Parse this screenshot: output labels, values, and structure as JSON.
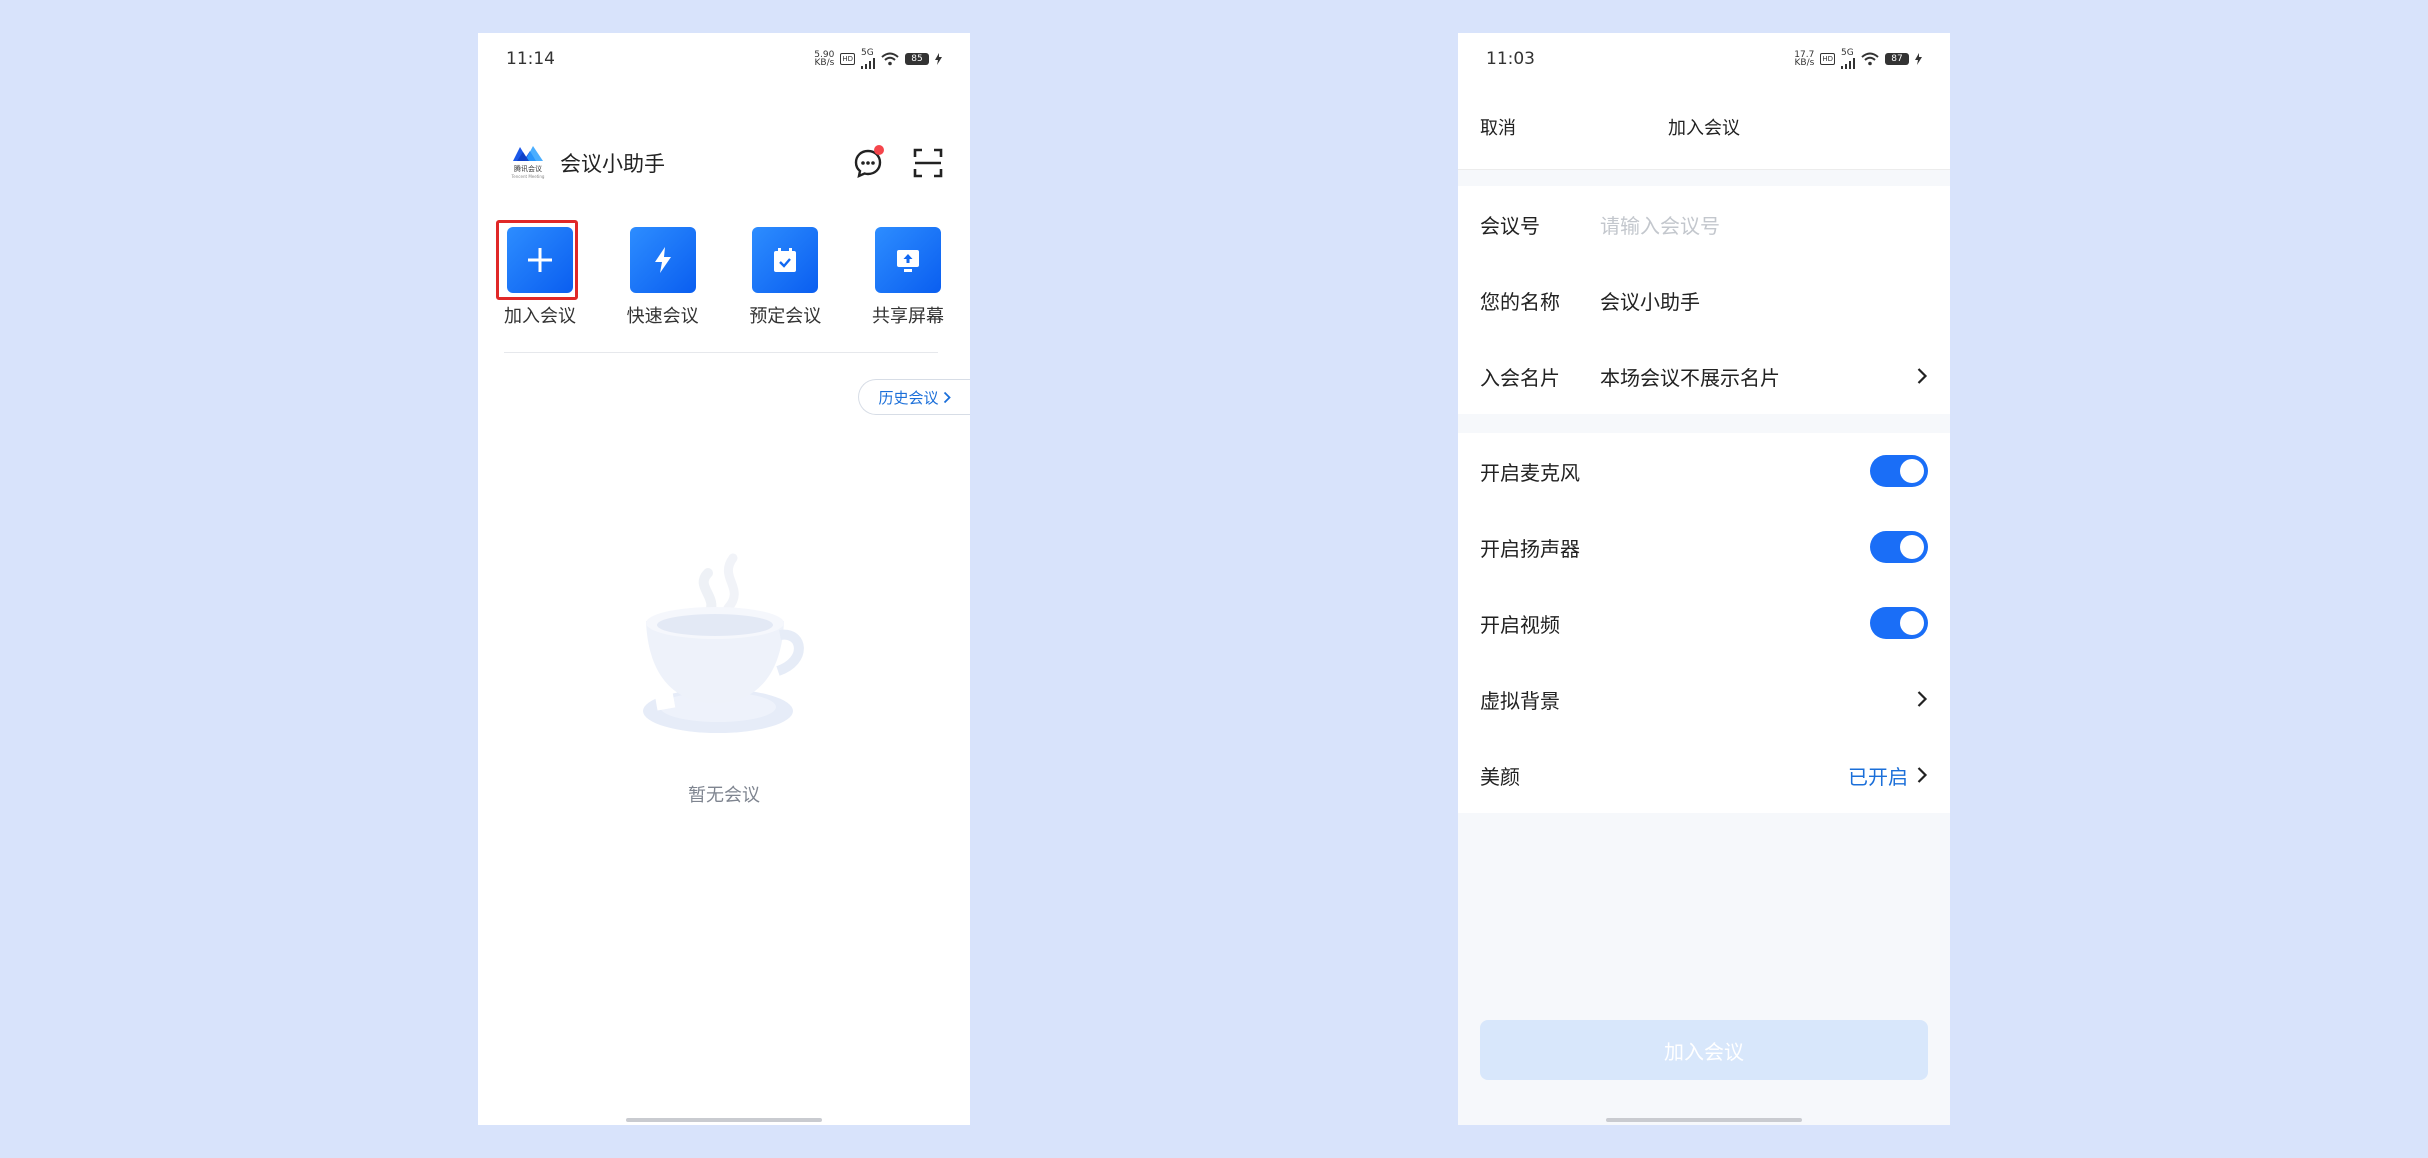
{
  "left_screen": {
    "status_bar": {
      "time": "11:14",
      "net_speed_top": "5.90",
      "net_speed_bottom": "KB/s",
      "net_type": "5G",
      "battery": "85"
    },
    "header": {
      "logo_text": "腾讯会议",
      "logo_subtext": "Tencent Meeting",
      "title": "会议小助手"
    },
    "actions": [
      {
        "label": "加入会议",
        "icon": "plus-icon"
      },
      {
        "label": "快速会议",
        "icon": "lightning-icon"
      },
      {
        "label": "预定会议",
        "icon": "calendar-check-icon"
      },
      {
        "label": "共享屏幕",
        "icon": "screen-share-icon"
      }
    ],
    "history_label": "历史会议",
    "empty_text": "暂无会议"
  },
  "right_screen": {
    "status_bar": {
      "time": "11:03",
      "net_speed_top": "17.7",
      "net_speed_bottom": "KB/s",
      "net_type": "5G",
      "battery": "87"
    },
    "nav": {
      "cancel": "取消",
      "title": "加入会议"
    },
    "meeting_id": {
      "label": "会议号",
      "placeholder": "请输入会议号"
    },
    "your_name": {
      "label": "您的名称",
      "value": "会议小助手"
    },
    "card": {
      "label": "入会名片",
      "value": "本场会议不展示名片"
    },
    "toggles": [
      {
        "label": "开启麦克风",
        "on": true
      },
      {
        "label": "开启扬声器",
        "on": true
      },
      {
        "label": "开启视频",
        "on": true
      }
    ],
    "virtual_bg": {
      "label": "虚拟背景"
    },
    "beauty": {
      "label": "美颜",
      "status": "已开启"
    },
    "join_button": "加入会议"
  },
  "colors": {
    "accent": "#1a6ef7",
    "link": "#1b6fd9",
    "highlight_border": "#e02828",
    "background": "#d8e3fb",
    "disabled_button": "#d8e7fb"
  }
}
